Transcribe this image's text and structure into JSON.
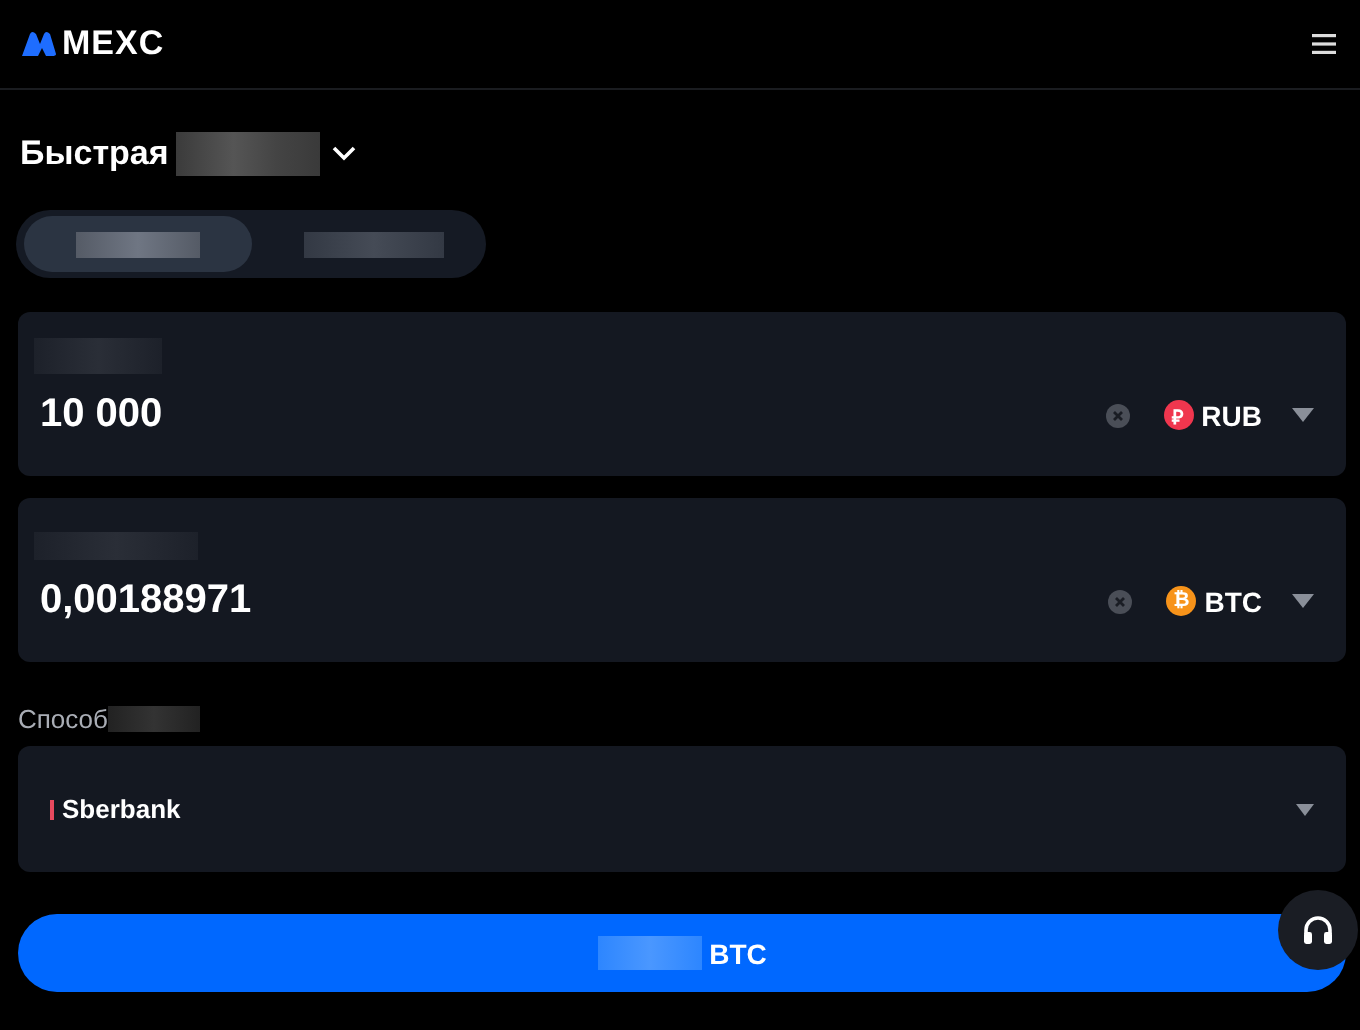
{
  "header": {
    "logo": "MEXC"
  },
  "title": "Быстрая",
  "tabs": [
    {
      "selected": true
    },
    {
      "selected": false
    }
  ],
  "amounts": [
    {
      "value": "10 000",
      "currency": "RUB",
      "symbol": "₽",
      "color": "#f0364e"
    },
    {
      "value": "0,00188971",
      "currency": "BTC",
      "symbol": "₿",
      "color": "#f7931a"
    }
  ],
  "method": {
    "label": "Способ",
    "value": "Sberbank"
  },
  "submit": {
    "label": "BTC"
  }
}
